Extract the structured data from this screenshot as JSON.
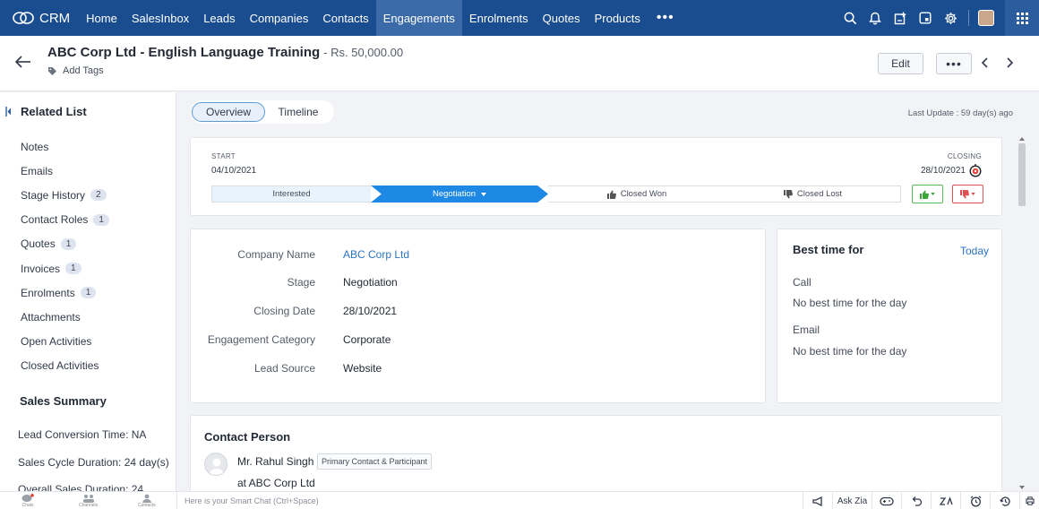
{
  "nav": {
    "brand": "CRM",
    "items": [
      "Home",
      "SalesInbox",
      "Leads",
      "Companies",
      "Contacts",
      "Engagements",
      "Enrolments",
      "Quotes",
      "Products"
    ],
    "active_index": 5,
    "more": "•••",
    "right_icons": [
      "search-icon",
      "bell-icon",
      "add-entry-icon",
      "calendar-icon",
      "gear-icon"
    ]
  },
  "header": {
    "title": "ABC Corp Ltd - English Language Training",
    "amount": "- Rs. 50,000.00",
    "add_tags": "Add Tags",
    "edit_label": "Edit",
    "more_label": "•••"
  },
  "sidebar": {
    "related_title": "Related List",
    "items": [
      {
        "label": "Notes",
        "count": ""
      },
      {
        "label": "Emails",
        "count": ""
      },
      {
        "label": "Stage History",
        "count": "2"
      },
      {
        "label": "Contact Roles",
        "count": "1"
      },
      {
        "label": "Quotes",
        "count": "1"
      },
      {
        "label": "Invoices",
        "count": "1"
      },
      {
        "label": "Enrolments",
        "count": "1"
      },
      {
        "label": "Attachments",
        "count": ""
      },
      {
        "label": "Open Activities",
        "count": ""
      },
      {
        "label": "Closed Activities",
        "count": ""
      }
    ],
    "summary_title": "Sales Summary",
    "summary": [
      "Lead Conversion Time: NA",
      "Sales Cycle Duration: 24 day(s)",
      "Overall Sales Duration: 24"
    ]
  },
  "tabs": {
    "overview": "Overview",
    "timeline": "Timeline",
    "last_update": "Last Update : 59 day(s) ago"
  },
  "stage": {
    "start_label": "START",
    "start_date": "04/10/2021",
    "closing_label": "CLOSING",
    "closing_date": "28/10/2021",
    "segments": {
      "interested": "Interested",
      "negotiation": "Negotiation",
      "closed_won": "Closed Won",
      "closed_lost": "Closed Lost"
    }
  },
  "details": [
    {
      "label": "Company Name",
      "value": "ABC Corp Ltd"
    },
    {
      "label": "Stage",
      "value": "Negotiation"
    },
    {
      "label": "Closing Date",
      "value": "28/10/2021"
    },
    {
      "label": "Engagement Category",
      "value": "Corporate"
    },
    {
      "label": "Lead Source",
      "value": "Website"
    }
  ],
  "best_time": {
    "title": "Best time for",
    "today": "Today",
    "call_label": "Call",
    "call_value": "No best time for the day",
    "email_label": "Email",
    "email_value": "No best time for the day"
  },
  "contact": {
    "title": "Contact Person",
    "name": "Mr. Rahul Singh",
    "role_tag": "Primary Contact & Participant",
    "company": "at ABC Corp Ltd"
  },
  "bottom": {
    "chats": "Chats",
    "channels": "Channels",
    "contacts": "Contacts",
    "smart_chat": "Here is your Smart Chat (Ctrl+Space)",
    "ask_zia": "Ask Zia"
  }
}
